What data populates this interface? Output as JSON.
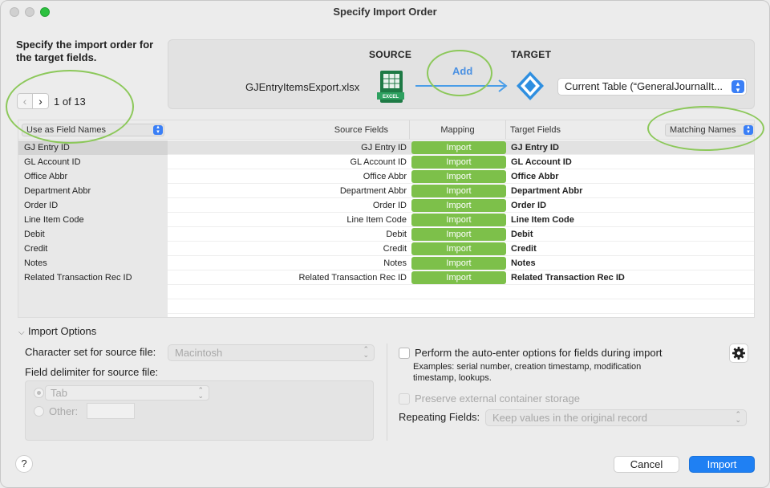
{
  "window": {
    "title": "Specify Import Order"
  },
  "instructions": "Specify the import order for the target fields.",
  "pager": {
    "prev_icon": "chevron-left-icon",
    "next_icon": "chevron-right-icon",
    "text": "1 of 13"
  },
  "source": {
    "label": "SOURCE",
    "file_name": "GJEntryItemsExport.xlsx",
    "file_icon": "excel-icon",
    "file_icon_text": "EXCEL"
  },
  "add_label": "Add",
  "target": {
    "label": "TARGET",
    "table_select": "Current Table (“GeneralJournalIt...",
    "icon": "filemaker-icon"
  },
  "table": {
    "use_as_select": "Use as Field Names",
    "col_source": "Source Fields",
    "col_mapping": "Mapping",
    "col_target": "Target Fields",
    "matching_select": "Matching Names",
    "rows": [
      {
        "left": "GJ Entry ID",
        "source": "GJ Entry ID",
        "mapping": "Import",
        "target": "GJ Entry ID"
      },
      {
        "left": "GL Account ID",
        "source": "GL Account ID",
        "mapping": "Import",
        "target": "GL Account ID"
      },
      {
        "left": "Office Abbr",
        "source": "Office Abbr",
        "mapping": "Import",
        "target": "Office Abbr"
      },
      {
        "left": "Department Abbr",
        "source": "Department Abbr",
        "mapping": "Import",
        "target": "Department Abbr"
      },
      {
        "left": "Order ID",
        "source": "Order ID",
        "mapping": "Import",
        "target": "Order ID"
      },
      {
        "left": "Line Item Code",
        "source": "Line Item Code",
        "mapping": "Import",
        "target": "Line Item Code"
      },
      {
        "left": "Debit",
        "source": "Debit",
        "mapping": "Import",
        "target": "Debit"
      },
      {
        "left": "Credit",
        "source": "Credit",
        "mapping": "Import",
        "target": "Credit"
      },
      {
        "left": "Notes",
        "source": "Notes",
        "mapping": "Import",
        "target": "Notes"
      },
      {
        "left": "Related Transaction Rec ID",
        "source": "Related Transaction Rec ID",
        "mapping": "Import",
        "target": "Related Transaction Rec ID"
      }
    ]
  },
  "import_options": {
    "toggle_label": "Import Options",
    "charset_label": "Character set for source file:",
    "charset_value": "Macintosh",
    "delimiter_label": "Field delimiter for source file:",
    "tab_value": "Tab",
    "other_label": "Other:",
    "auto_enter_label": "Perform the auto-enter options for fields during import",
    "auto_enter_examples": "Examples: serial number, creation timestamp, modification timestamp, lookups.",
    "preserve_label": "Preserve external container storage",
    "repeating_label": "Repeating Fields:",
    "repeating_value": "Keep values in the original record"
  },
  "footer": {
    "help": "?",
    "cancel": "Cancel",
    "import": "Import"
  },
  "colors": {
    "accent": "#1f80f3",
    "mapping_green": "#7dc04a",
    "annotation_green": "#8cc85a",
    "link_blue": "#4a90e2"
  }
}
